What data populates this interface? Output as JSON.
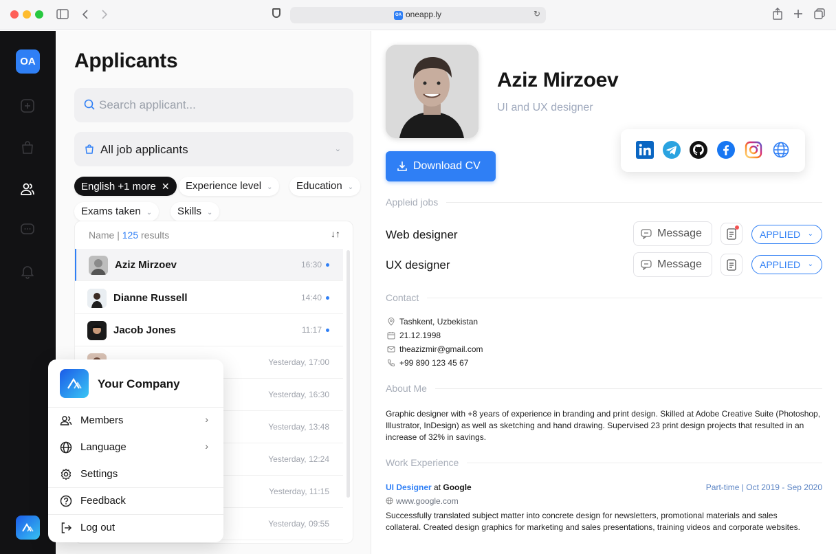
{
  "browser": {
    "url": "oneapp.ly",
    "url_badge": "OA"
  },
  "sidebar": {
    "logo_text": "OA",
    "icons": [
      "add-icon",
      "bag-icon",
      "users-icon",
      "chat-icon",
      "bell-icon"
    ]
  },
  "applicants": {
    "title": "Applicants",
    "search_placeholder": "Search applicant...",
    "filter_select": "All job applicants",
    "chips": {
      "language": "English +1 more",
      "experience": "Experience level",
      "education": "Education",
      "exams": "Exams taken",
      "skills": "Skills"
    },
    "list_header_name": "Name | ",
    "list_header_count": "125",
    "list_header_suffix": " results",
    "rows": [
      {
        "name": "Aziz Mirzoev",
        "time": "16:30"
      },
      {
        "name": "Dianne Russell",
        "time": "14:40"
      },
      {
        "name": "Jacob Jones",
        "time": "11:17"
      },
      {
        "name": "",
        "time": "Yesterday, 17:00"
      },
      {
        "name": "",
        "time": "Yesterday, 16:30"
      },
      {
        "name": "",
        "time": "Yesterday, 13:48"
      },
      {
        "name": "",
        "time": "Yesterday, 12:24"
      },
      {
        "name": "",
        "time": "Yesterday, 11:15"
      },
      {
        "name": "",
        "time": "Yesterday, 09:55"
      }
    ]
  },
  "company_menu": {
    "company": "Your Company",
    "items": [
      {
        "label": "Members"
      },
      {
        "label": "Language"
      },
      {
        "label": "Settings"
      },
      {
        "label": "Feedback"
      },
      {
        "label": "Log out"
      }
    ]
  },
  "profile": {
    "name": "Aziz Mirzoev",
    "role": "UI and UX designer",
    "download_cv": "Download CV",
    "socials": [
      "linkedin-icon",
      "telegram-icon",
      "github-icon",
      "facebook-icon",
      "instagram-icon",
      "website-icon"
    ],
    "applied_jobs_title": "Appleid jobs",
    "jobs": [
      {
        "title": "Web designer",
        "message": "Message",
        "status": "APPLIED"
      },
      {
        "title": "UX designer",
        "message": "Message",
        "status": "APPLIED"
      }
    ],
    "contact_title": "Contact",
    "contact": {
      "location": "Tashkent, Uzbekistan",
      "birthday": "21.12.1998",
      "email": "theazizmir@gmail.com",
      "phone": "+99 890 123 45 67"
    },
    "about_title": "About Me",
    "about_text": "Graphic designer with +8 years of experience in branding and print design. Skilled at Adobe Creative Suite (Photoshop, Illustrator, InDesign) as well as sketching and hand drawing. Supervised 23 print design projects that resulted in an increase of 32% in savings.",
    "work_title": "Work Experience",
    "work": {
      "role": "UI Designer",
      "at": " at ",
      "company": "Google",
      "period": "Part-time | Oct 2019 - Sep 2020",
      "site": "www.google.com",
      "description": "Successfully translated subject matter into concrete design for newsletters, promotional materials and sales collateral. Created design graphics for marketing and sales presentations, training videos and corporate websites."
    }
  },
  "colors": {
    "accent": "#2f7ff5",
    "sidebar_bg": "#121214",
    "status_unread": "#2f7ff5",
    "notification": "#f35353"
  }
}
